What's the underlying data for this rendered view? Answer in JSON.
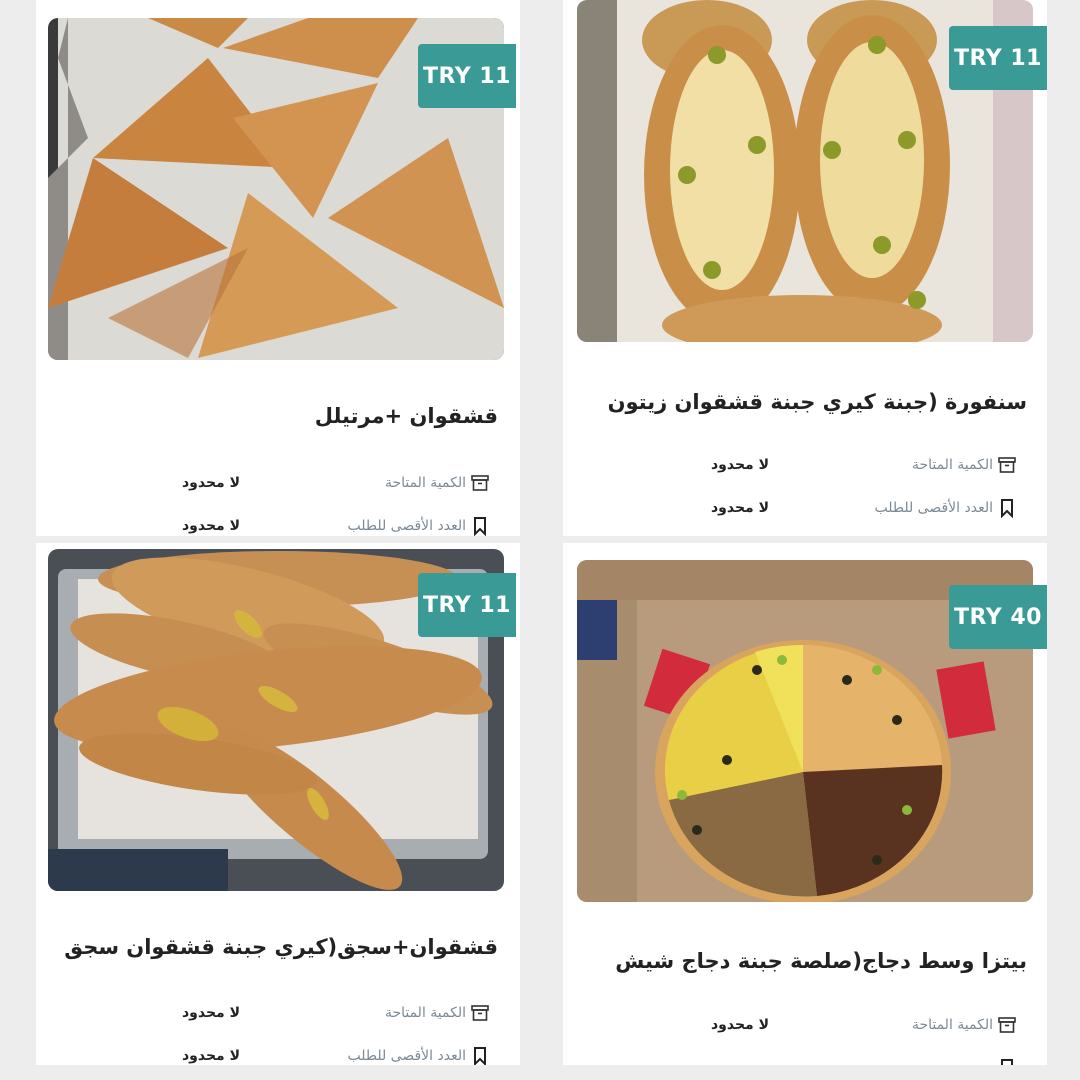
{
  "products": [
    {
      "title": "قشقوان +مرتيلل",
      "price": "TRY 11",
      "image": "triangle-pastries",
      "rows": [
        {
          "icon": "archive-icon",
          "label": "الكمية المتاحة",
          "value": "لا محدود"
        },
        {
          "icon": "bookmark-icon",
          "label": "العدد الأقصى للطلب",
          "value": "لا محدود"
        }
      ]
    },
    {
      "title": "سنفورة (جبنة كيري جبنة قشقوان زيتون",
      "price": "TRY 11",
      "image": "cheese-boat-pastries",
      "rows": [
        {
          "icon": "archive-icon",
          "label": "الكمية المتاحة",
          "value": "لا محدود"
        },
        {
          "icon": "bookmark-icon",
          "label": "العدد الأقصى للطلب",
          "value": "لا محدود"
        }
      ]
    },
    {
      "title": "قشقوان+سجق(كيري جبنة قشقوان سجق",
      "price": "TRY 11",
      "image": "sausage-rolls",
      "rows": [
        {
          "icon": "archive-icon",
          "label": "الكمية المتاحة",
          "value": "لا محدود"
        },
        {
          "icon": "bookmark-icon",
          "label": "العدد الأقصى للطلب",
          "value": "لا محدود"
        }
      ]
    },
    {
      "title": "بيتزا وسط دجاج(صلصة جبنة دجاج شيش",
      "price": "TRY 40",
      "image": "pizza-in-box",
      "rows": [
        {
          "icon": "archive-icon",
          "label": "الكمية المتاحة",
          "value": "لا محدود"
        }
      ]
    }
  ],
  "colors": {
    "badge": "#3a9a96",
    "label": "#7a8a96",
    "title": "#222222",
    "background": "#ededed"
  }
}
